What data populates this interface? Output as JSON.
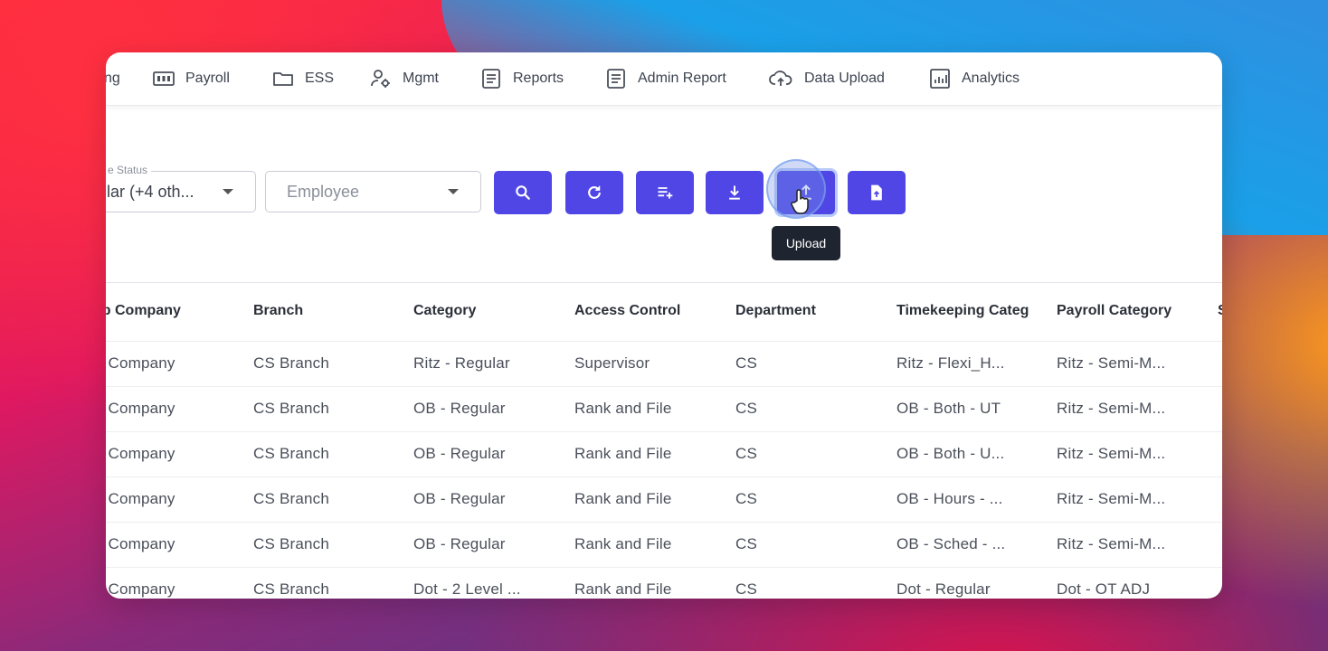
{
  "nav": {
    "items": [
      {
        "label": "ng",
        "icon": "none"
      },
      {
        "label": "Payroll",
        "icon": "payroll-icon"
      },
      {
        "label": "ESS",
        "icon": "folder-icon"
      },
      {
        "label": "Mgmt",
        "icon": "user-settings-icon"
      },
      {
        "label": "Reports",
        "icon": "document-icon"
      },
      {
        "label": "Admin Report",
        "icon": "document-icon"
      },
      {
        "label": "Data Upload",
        "icon": "cloud-upload-icon"
      },
      {
        "label": "Analytics",
        "icon": "analytics-icon"
      }
    ]
  },
  "filters": {
    "status_label": "e Status",
    "status_value": "lar (+4 oth...",
    "employee_placeholder": "Employee"
  },
  "toolbar": {
    "accent": "#4f46e5",
    "buttons": [
      "search-icon",
      "refresh-icon",
      "add-list-icon",
      "download-icon",
      "upload-icon",
      "file-upload-icon"
    ],
    "tooltip": "Upload"
  },
  "table": {
    "headers": [
      "ub Company",
      "Branch",
      "Category",
      "Access Control",
      "Department",
      "Timekeeping Categ",
      "Payroll Category",
      "S"
    ],
    "rows": [
      [
        "S Company",
        "CS Branch",
        "Ritz - Regular",
        "Supervisor",
        "CS",
        "Ritz - Flexi_H...",
        "Ritz - Semi-M..."
      ],
      [
        "S Company",
        "CS Branch",
        "OB - Regular",
        "Rank and File",
        "CS",
        "OB - Both - UT",
        "Ritz - Semi-M..."
      ],
      [
        "S Company",
        "CS Branch",
        "OB - Regular",
        "Rank and File",
        "CS",
        "OB - Both - U...",
        "Ritz - Semi-M..."
      ],
      [
        "S Company",
        "CS Branch",
        "OB - Regular",
        "Rank and File",
        "CS",
        "OB - Hours - ...",
        "Ritz - Semi-M..."
      ],
      [
        "S Company",
        "CS Branch",
        "OB - Regular",
        "Rank and File",
        "CS",
        "OB - Sched - ...",
        "Ritz - Semi-M..."
      ],
      [
        "S Company",
        "CS Branch",
        "Dot - 2 Level ...",
        "Rank and File",
        "CS",
        "Dot - Regular",
        "Dot - OT ADJ"
      ]
    ]
  }
}
